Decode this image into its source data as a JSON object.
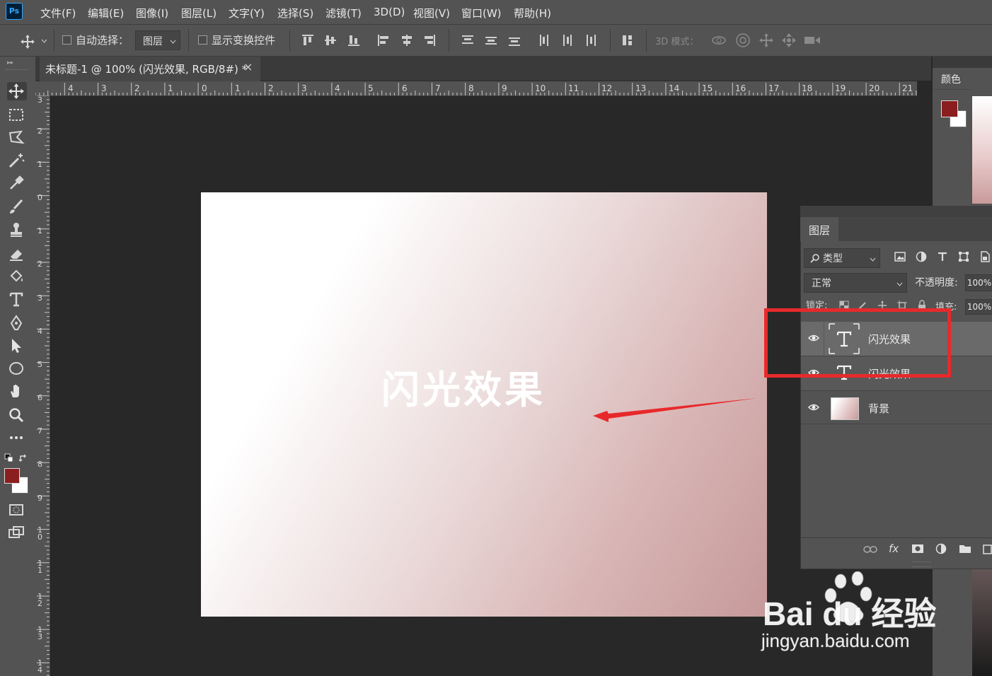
{
  "app": {
    "logo": "Ps"
  },
  "menu": [
    "文件(F)",
    "编辑(E)",
    "图像(I)",
    "图层(L)",
    "文字(Y)",
    "选择(S)",
    "滤镜(T)",
    "3D(D)",
    "视图(V)",
    "窗口(W)",
    "帮助(H)"
  ],
  "options": {
    "auto_select_label": "自动选择：",
    "auto_select_value": "图层",
    "show_transform_label": "显示变换控件",
    "mode_3d_label": "3D 模式："
  },
  "document_tab": {
    "title": "未标题-1 @ 100% (闪光效果, RGB/8#) *",
    "close": "×"
  },
  "ruler": {
    "h": [
      "4",
      "3",
      "2",
      "1",
      "0",
      "1",
      "2",
      "3",
      "4",
      "5",
      "6",
      "7",
      "8",
      "9",
      "10",
      "11",
      "12",
      "13",
      "14",
      "15",
      "16",
      "17",
      "18",
      "19",
      "20",
      "21"
    ],
    "v": [
      "3",
      "2",
      "1",
      "0",
      "1",
      "2",
      "3",
      "4",
      "5",
      "6",
      "7",
      "8",
      "9",
      "10",
      "11",
      "12",
      "13",
      "14"
    ]
  },
  "canvas": {
    "text": "闪光效果"
  },
  "colors": {
    "foreground": "#8b1e1e",
    "background": "#ffffff",
    "accent_red": "#e8292b"
  },
  "color_panel": {
    "tab": "颜色"
  },
  "layers_panel": {
    "tab": "图层",
    "filter_label": "类型",
    "blend_mode": "正常",
    "opacity_label": "不透明度:",
    "opacity_value": "100%",
    "lock_label": "锁定:",
    "fill_label": "填充:",
    "fill_value": "100%",
    "layers": [
      {
        "name": "闪光效果",
        "type": "text",
        "selected": true
      },
      {
        "name": "闪光效果",
        "type": "text",
        "selected": false
      },
      {
        "name": "背景",
        "type": "gradient",
        "selected": false
      }
    ],
    "footer_fx": "fx"
  },
  "watermark": {
    "brand": "Bai du 经验",
    "url": "jingyan.baidu.com"
  }
}
